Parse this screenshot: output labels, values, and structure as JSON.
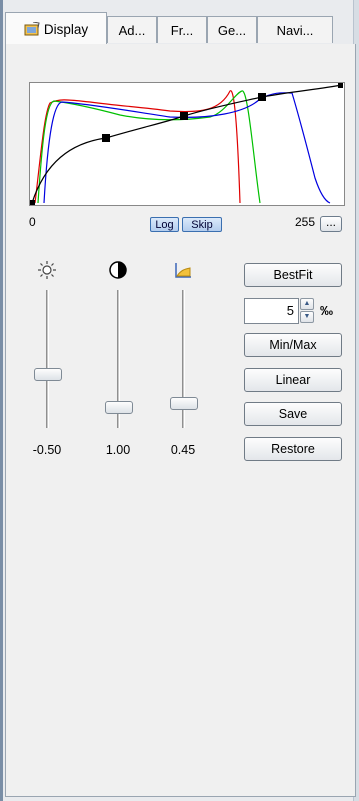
{
  "tabs": [
    {
      "label": "Display",
      "active": true
    },
    {
      "label": "Ad...",
      "active": false
    },
    {
      "label": "Fr...",
      "active": false
    },
    {
      "label": "Ge...",
      "active": false
    },
    {
      "label": "Navi...",
      "active": false
    }
  ],
  "histogram": {
    "min_label": "0",
    "max_label": "255",
    "more_label": "...",
    "log_label": "Log",
    "skip_label": "Skip",
    "curve_color": "#000000",
    "channel_colors": {
      "red": "#e00000",
      "green": "#00c000",
      "blue": "#0000e0"
    }
  },
  "sliders": [
    {
      "icon": "brightness-icon",
      "value_text": "-0.50",
      "level": 0.62
    },
    {
      "icon": "contrast-icon",
      "value_text": "1.00",
      "level": 0.18
    },
    {
      "icon": "gamma-icon",
      "value_text": "0.45",
      "level": 0.22
    }
  ],
  "actions": {
    "bestfit": "BestFit",
    "spin_value": "5",
    "spin_unit": "‰",
    "minmax": "Min/Max",
    "linear": "Linear",
    "save": "Save",
    "restore": "Restore"
  }
}
